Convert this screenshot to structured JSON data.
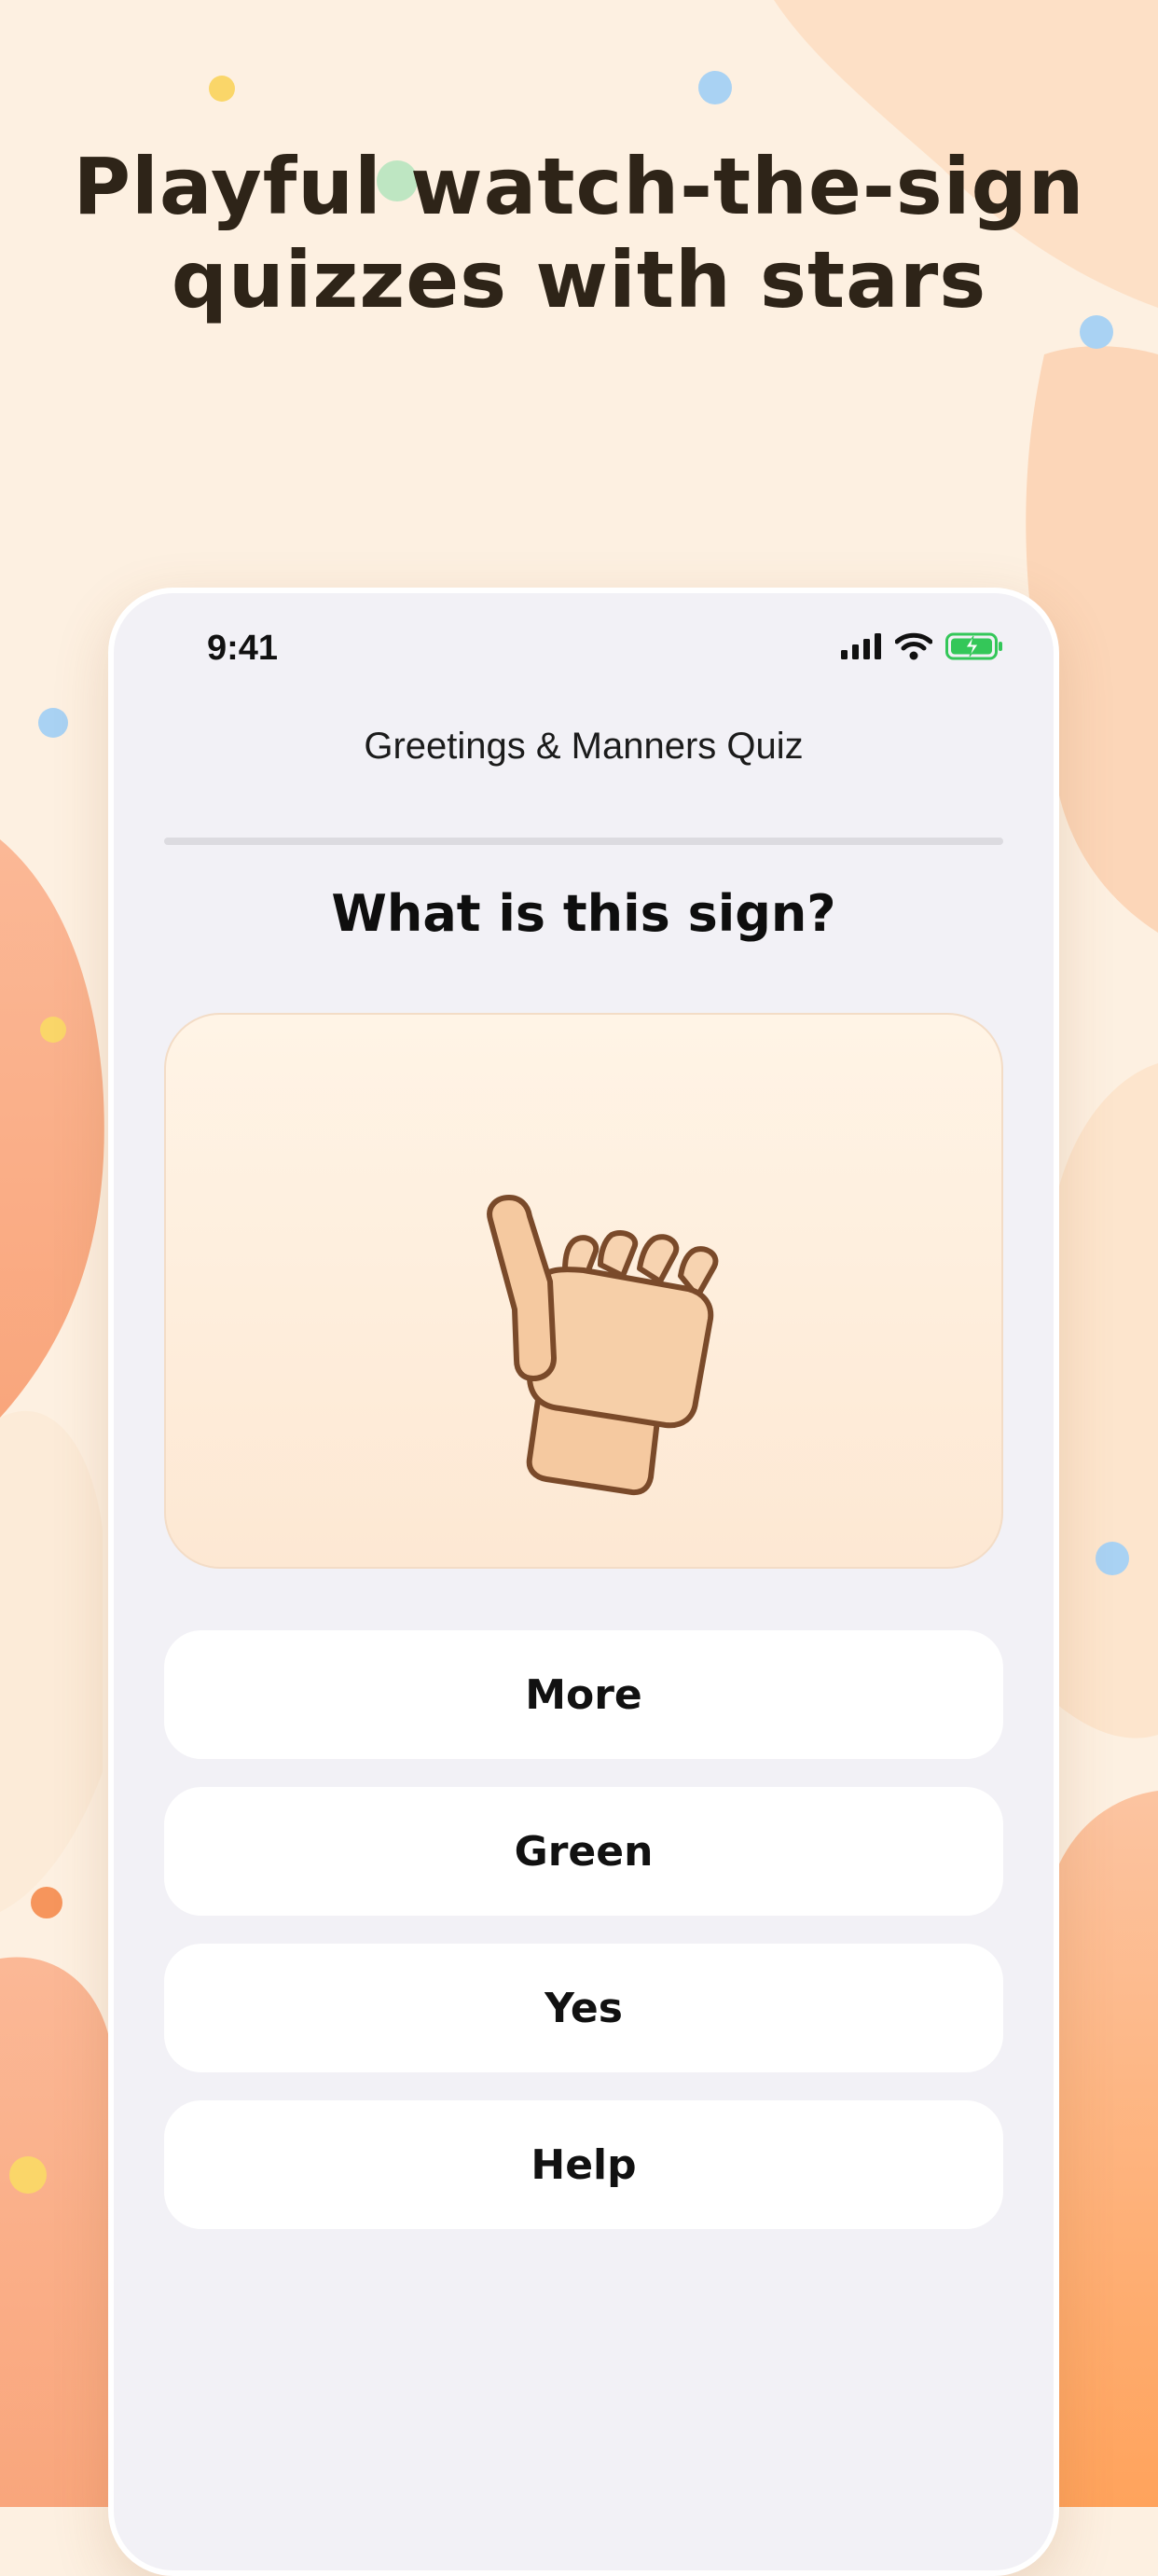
{
  "headline": {
    "line1": "Playful watch-the-sign",
    "line2": "quizzes with stars"
  },
  "status_bar": {
    "time": "9:41",
    "icons": [
      "cellular-signal-icon",
      "wifi-icon",
      "battery-charging-icon"
    ]
  },
  "quiz": {
    "title": "Greetings & Manners Quiz",
    "progress": 0,
    "question": "What is this sign?",
    "sign_illustration": "fist-hand-sign-icon",
    "answers": [
      {
        "label": "More"
      },
      {
        "label": "Green"
      },
      {
        "label": "Yes"
      },
      {
        "label": "Help"
      }
    ]
  },
  "colors": {
    "background": "#fdf0e1",
    "accent_orange": "#ff9a4a",
    "battery_green": "#34c759",
    "card_bg": "#f2f1f6"
  }
}
